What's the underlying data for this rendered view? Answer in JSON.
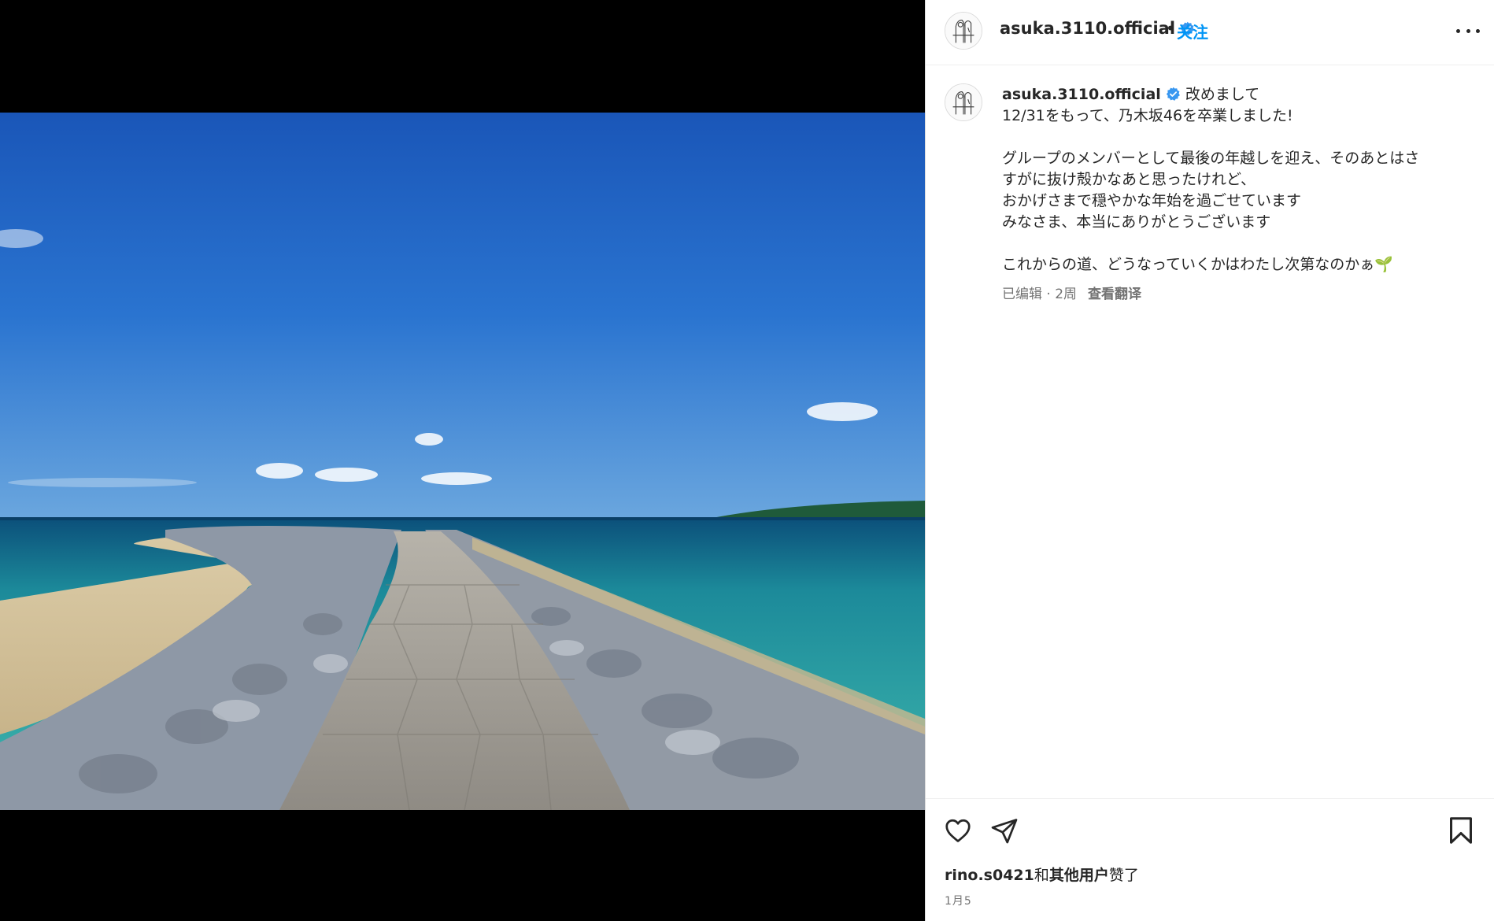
{
  "post": {
    "username": "asuka.3110.official",
    "separator": "•",
    "follow_label": "关注",
    "caption": {
      "username": "asuka.3110.official",
      "first_line": "改めまして",
      "lines": [
        "12/31をもって、乃木坂46を卒業しました!",
        "",
        "グループのメンバーとして最後の年越しを迎え、そのあとはさ",
        "すがに抜け殻かなあと思ったけれど、",
        "おかげさまで穏やかな年始を過ごせています",
        "みなさま、本当にありがとうございます",
        "",
        "これからの道、どうなっていくかはわたし次第なのかぁ🌱"
      ]
    },
    "meta": {
      "edited": "已编辑 · 2周",
      "translate": "查看翻译"
    },
    "likes": {
      "user": "rino.s0421",
      "conj": "和",
      "others": "其他用户",
      "suffix": "赞了"
    },
    "date": "1月5"
  },
  "colors": {
    "follow": "#0095f6",
    "verified": "#3897f0",
    "text": "#262626",
    "secondary": "#737373"
  },
  "icons": [
    "verified-badge-icon",
    "more-options-icon",
    "heart-icon",
    "paper-plane-icon",
    "bookmark-icon"
  ]
}
